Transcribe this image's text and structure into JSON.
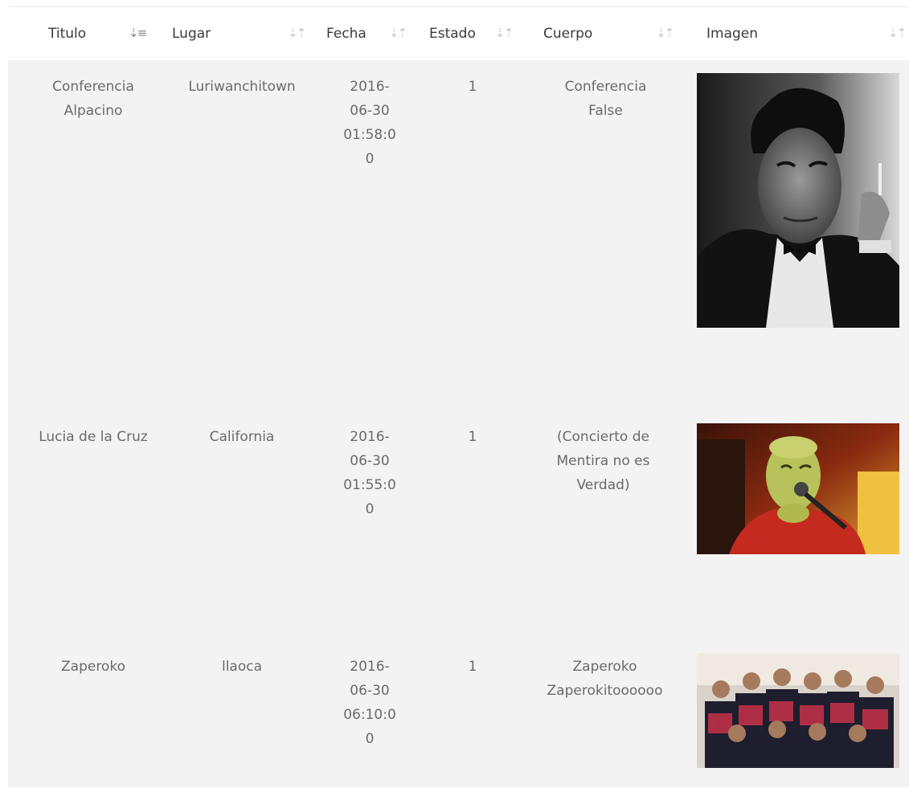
{
  "table": {
    "headers": [
      {
        "label": "Titulo",
        "sort_icon": "sort-asc-icon",
        "active": true
      },
      {
        "label": "Lugar",
        "sort_icon": "sort-icon",
        "active": false
      },
      {
        "label": "Fecha",
        "sort_icon": "sort-icon",
        "active": false
      },
      {
        "label": "Estado",
        "sort_icon": "sort-icon",
        "active": false
      },
      {
        "label": "Cuerpo",
        "sort_icon": "sort-icon",
        "active": false
      },
      {
        "label": "Imagen",
        "sort_icon": "sort-icon",
        "active": false
      }
    ],
    "rows": [
      {
        "titulo": "Conferencia Alpacino",
        "lugar": "Luriwanchitown",
        "fecha": "2016-06-30 01:58:00",
        "estado": "1",
        "cuerpo": "Conferencia False",
        "imagen": "portrait-man-in-tuxedo-image"
      },
      {
        "titulo": "Lucia de la Cruz",
        "lugar": "California",
        "fecha": "2016-06-30 01:55:00",
        "estado": "1",
        "cuerpo": "(Concierto de Mentira no es Verdad)",
        "imagen": "singer-with-microphone-image"
      },
      {
        "titulo": "Zaperoko",
        "lugar": "llaoca",
        "fecha": "2016-06-30 06:10:00",
        "estado": "1",
        "cuerpo": "Zaperoko Zaperokitoooooo",
        "imagen": "band-group-photo-image"
      }
    ]
  }
}
